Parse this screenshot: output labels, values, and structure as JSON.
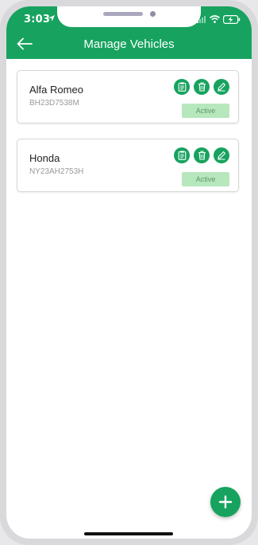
{
  "status_bar": {
    "time": "3:03",
    "icons": [
      "location-arrow-icon",
      "signal-icon",
      "wifi-icon",
      "battery-charging-icon"
    ]
  },
  "app_bar": {
    "title": "Manage Vehicles",
    "back_icon": "arrow-left-icon"
  },
  "vehicles": [
    {
      "name": "Alfa Romeo",
      "plate": "BH23D7538M",
      "status": "Active"
    },
    {
      "name": "Honda",
      "plate": "NY23AH2753H",
      "status": "Active"
    }
  ],
  "card_actions": [
    "document-icon",
    "trash-icon",
    "edit-icon"
  ],
  "fab": {
    "icon": "plus-icon"
  },
  "colors": {
    "primary": "#17a35f",
    "badge_bg": "#b7e7bd",
    "badge_text": "#5c9a66"
  }
}
